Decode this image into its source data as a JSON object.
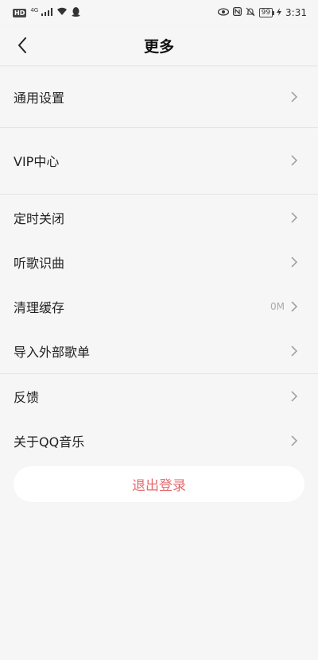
{
  "status_bar": {
    "hd": "HD",
    "network": "4G",
    "battery": "99",
    "time": "3:31"
  },
  "header": {
    "title": "更多"
  },
  "menu": {
    "items": [
      {
        "label": "通用设置",
        "value": ""
      },
      {
        "label": "VIP中心",
        "value": ""
      },
      {
        "label": "定时关闭",
        "value": ""
      },
      {
        "label": "听歌识曲",
        "value": ""
      },
      {
        "label": "清理缓存",
        "value": "0M"
      },
      {
        "label": "导入外部歌单",
        "value": ""
      },
      {
        "label": "反馈",
        "value": ""
      },
      {
        "label": "关于QQ音乐",
        "value": ""
      }
    ]
  },
  "logout": {
    "label": "退出登录"
  },
  "colors": {
    "background": "#f6f6f6",
    "accent": "#e76a6d"
  }
}
